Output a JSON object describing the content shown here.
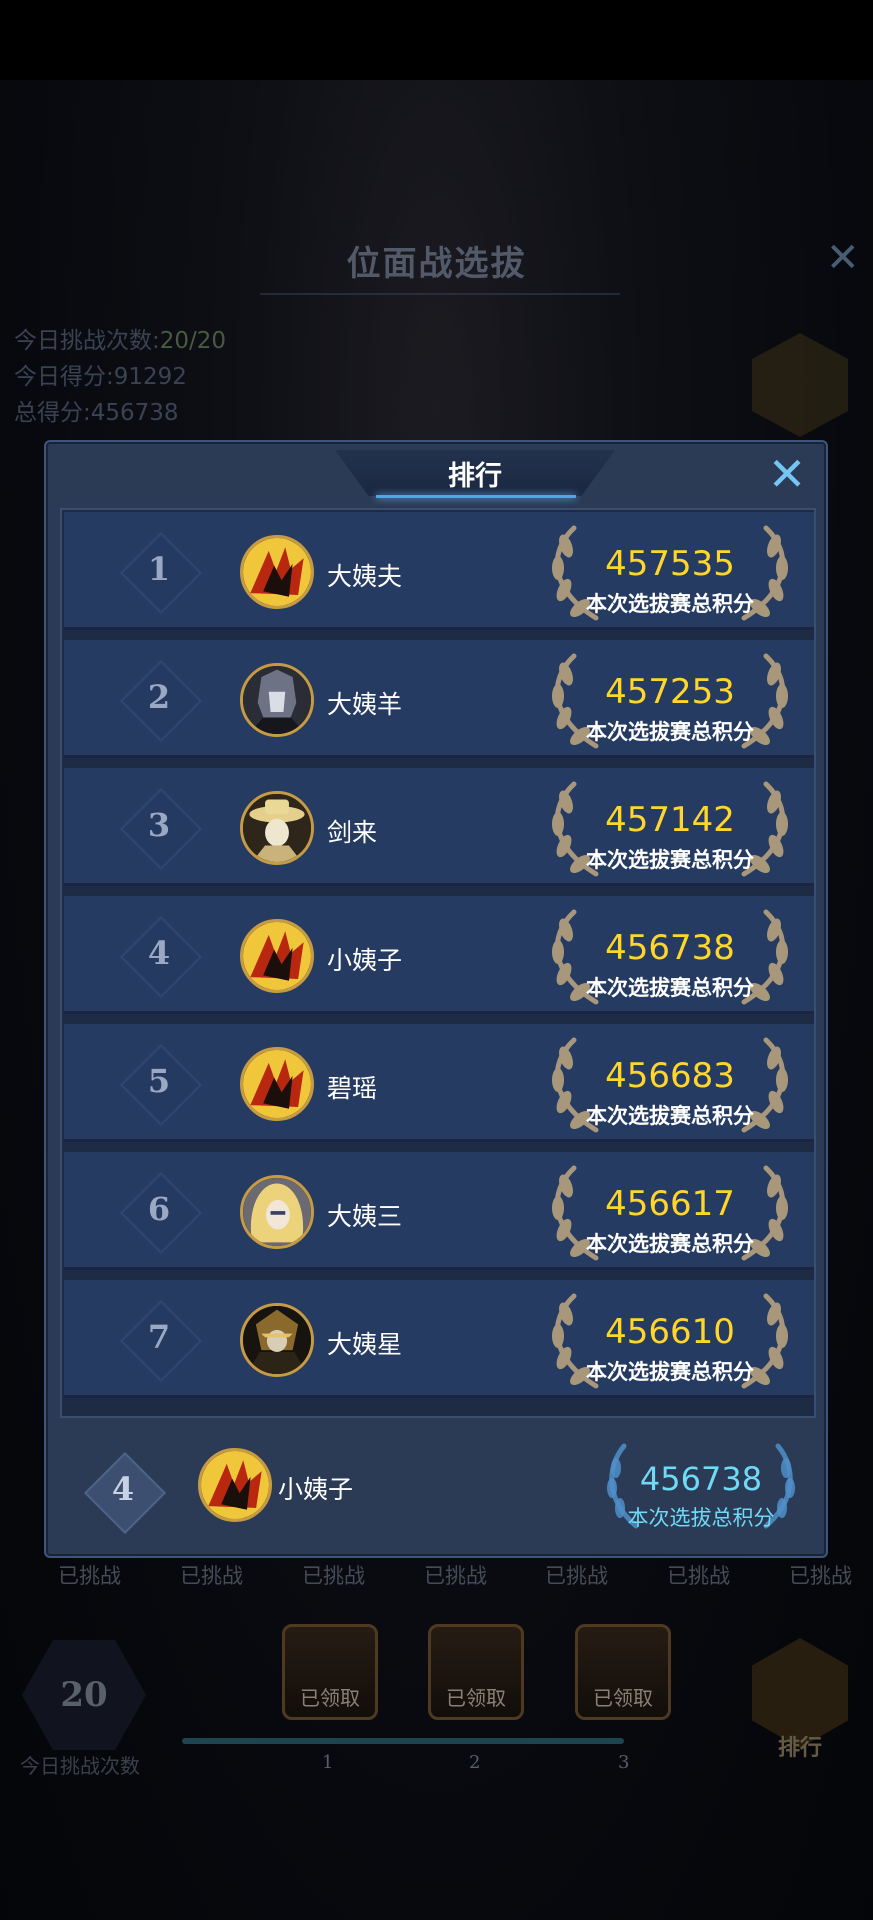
{
  "background": {
    "title": "位面战选拔",
    "stats": [
      {
        "label": "今日挑战次数:",
        "value": "20/20"
      },
      {
        "label": "今日得分:",
        "value": "91292"
      },
      {
        "label": "总得分:",
        "value": "456738"
      }
    ],
    "challenged_label": "已挑战",
    "remaining_count": "20",
    "remaining_label": "今日挑战次数",
    "chests": [
      {
        "label": "已领取",
        "step": "1"
      },
      {
        "label": "已领取",
        "step": "2"
      },
      {
        "label": "已领取",
        "step": "3"
      }
    ],
    "rank_button_label": "排行"
  },
  "modal": {
    "title": "排行",
    "rows": [
      {
        "rank": "1",
        "name": "大姨夫",
        "score": "457535",
        "score_label": "本次选拔赛总积分",
        "avatar": "gold-flame"
      },
      {
        "rank": "2",
        "name": "大姨羊",
        "score": "457253",
        "score_label": "本次选拔赛总积分",
        "avatar": "dark-knight"
      },
      {
        "rank": "3",
        "name": "剑来",
        "score": "457142",
        "score_label": "本次选拔赛总积分",
        "avatar": "hat-swordsman"
      },
      {
        "rank": "4",
        "name": "小姨子",
        "score": "456738",
        "score_label": "本次选拔赛总积分",
        "avatar": "gold-flame"
      },
      {
        "rank": "5",
        "name": "碧瑶",
        "score": "456683",
        "score_label": "本次选拔赛总积分",
        "avatar": "gold-flame"
      },
      {
        "rank": "6",
        "name": "大姨三",
        "score": "456617",
        "score_label": "本次选拔赛总积分",
        "avatar": "blonde-girl"
      },
      {
        "rank": "7",
        "name": "大姨星",
        "score": "456610",
        "score_label": "本次选拔赛总积分",
        "avatar": "dark-mage"
      }
    ],
    "self": {
      "rank": "4",
      "name": "小姨子",
      "score": "456738",
      "score_label": "本次选拔总积分"
    }
  },
  "colors": {
    "score_gold": "#ffd629",
    "self_score": "#6fd9f6",
    "panel": "#263b62"
  }
}
